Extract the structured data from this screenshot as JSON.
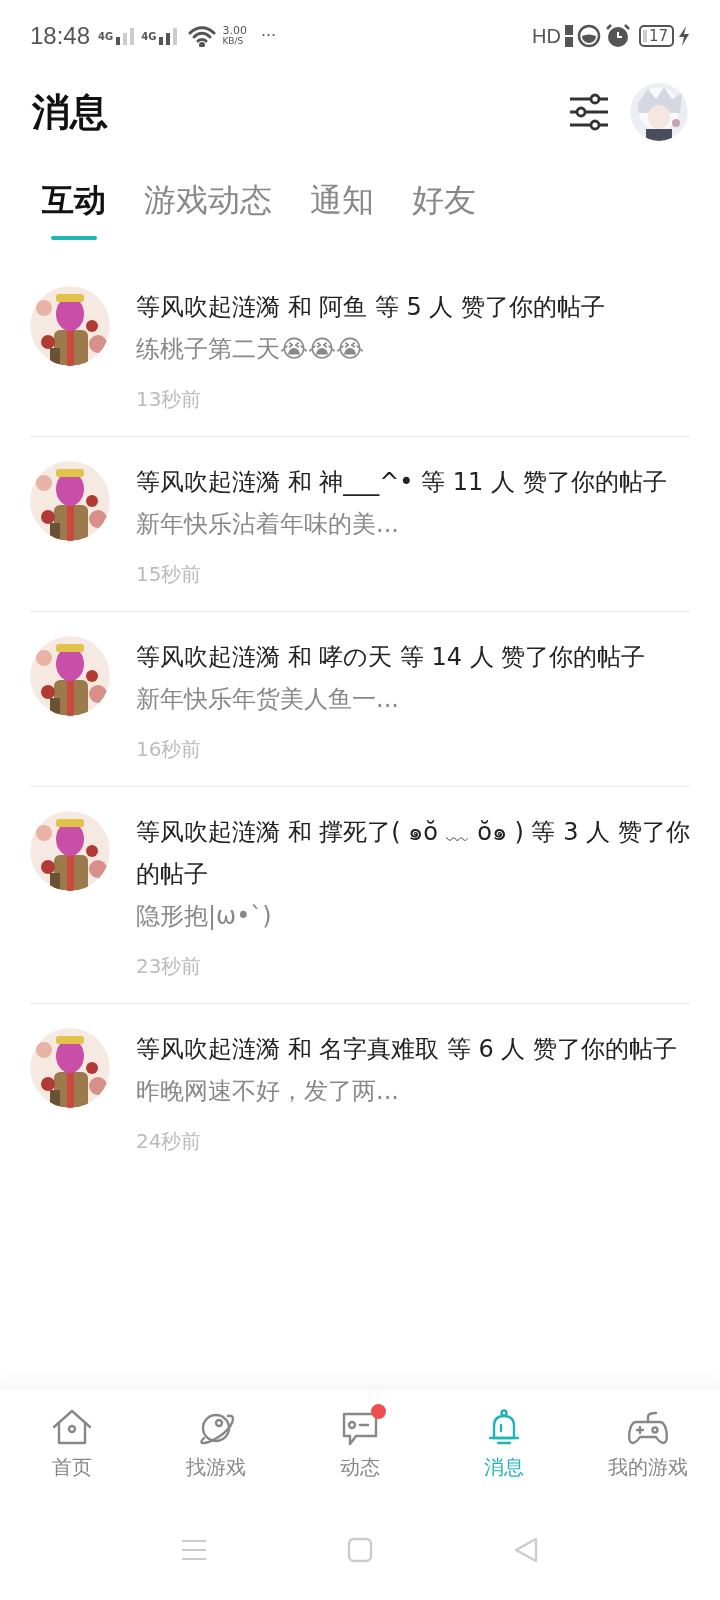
{
  "status_bar": {
    "time": "18:48",
    "sim1": "4G",
    "sim2": "4G",
    "speed_value": "3.00",
    "speed_unit": "KB/S",
    "more": "···",
    "hd": "HD",
    "battery": "17"
  },
  "header": {
    "title": "消息"
  },
  "tabs": [
    {
      "label": "互动",
      "selected": true
    },
    {
      "label": "游戏动态",
      "selected": false
    },
    {
      "label": "通知",
      "selected": false
    },
    {
      "label": "好友",
      "selected": false
    }
  ],
  "notifications": [
    {
      "text": "等风吹起涟漪 和 阿鱼 等 5 人 赞了你的帖子",
      "preview": "练桃子第二天😭😭😭",
      "time": "13秒前"
    },
    {
      "text": "等风吹起涟漪 和 神___^• 等 11 人 赞了你的帖子",
      "preview": "新年快乐沾着年味的美...",
      "time": "15秒前"
    },
    {
      "text": "等风吹起涟漪 和 哮の天 等 14 人 赞了你的帖子",
      "preview": "新年快乐年货美人鱼一...",
      "time": "16秒前"
    },
    {
      "text": "等风吹起涟漪 和 撑死了( ๑ŏ ﹏ ŏ๑ ) 等 3 人 赞了你的帖子",
      "preview": "隐形抱|ω•`)",
      "time": "23秒前"
    },
    {
      "text": "等风吹起涟漪 和 名字真难取 等 6 人 赞了你的帖子",
      "preview": "昨晚网速不好，发了两...",
      "time": "24秒前"
    }
  ],
  "bottom_nav": [
    {
      "kind": "home",
      "label": "首页",
      "selected": false,
      "badge": false
    },
    {
      "kind": "planet",
      "label": "找游戏",
      "selected": false,
      "badge": false
    },
    {
      "kind": "chat",
      "label": "动态",
      "selected": false,
      "badge": true
    },
    {
      "kind": "bell",
      "label": "消息",
      "selected": true,
      "badge": false
    },
    {
      "kind": "gamepad",
      "label": "我的游戏",
      "selected": false,
      "badge": false
    }
  ]
}
